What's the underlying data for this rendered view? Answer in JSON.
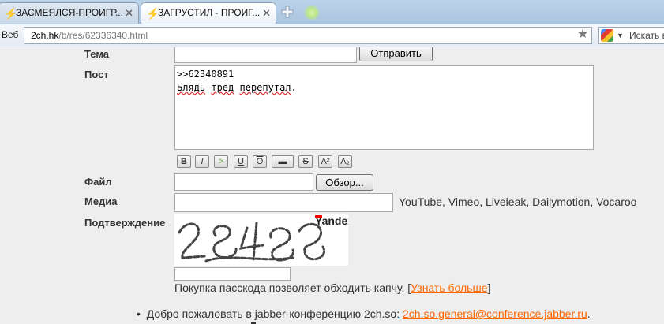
{
  "tabs": [
    {
      "title": "ЗАСМЕЯЛСЯ-ПРОИГР...",
      "close": "✕"
    },
    {
      "title": "ЗАГРУСТИЛ - ПРОИГ...",
      "close": "✕"
    }
  ],
  "toolbar": {
    "web_label": "Веб",
    "url_host": "2ch.hk",
    "url_path": "/b/res/62336340.html",
    "search_placeholder": "Искать в"
  },
  "form": {
    "theme_label": "Тема",
    "send_button": "Отправить",
    "post_label": "Пост",
    "post_line1": ">>62340891",
    "post_line2_w1": "Блядь",
    "post_line2_w2": "тред",
    "post_line2_w3": "перепутал",
    "post_line2_end": ".",
    "format_buttons": [
      "B",
      "I",
      ">",
      "U",
      "O",
      "▬",
      "S",
      "A²",
      "A₂"
    ],
    "file_label": "Файл",
    "browse_button": "Обзор...",
    "media_label": "Медиа",
    "media_hint": "YouTube, Vimeo, Liveleak, Dailymotion, Vocaroo",
    "confirm_label": "Подтверждение",
    "captcha_brand": "Yandex",
    "captcha_note": "Покупка пасскода позволяет обходить капчу.",
    "captcha_link": "Узнать больше"
  },
  "rules": {
    "jabber_text": "Добро пожаловать в jabber-конференцию 2ch.so:",
    "jabber_link": "2ch.so.general@conference.jabber.ru"
  }
}
